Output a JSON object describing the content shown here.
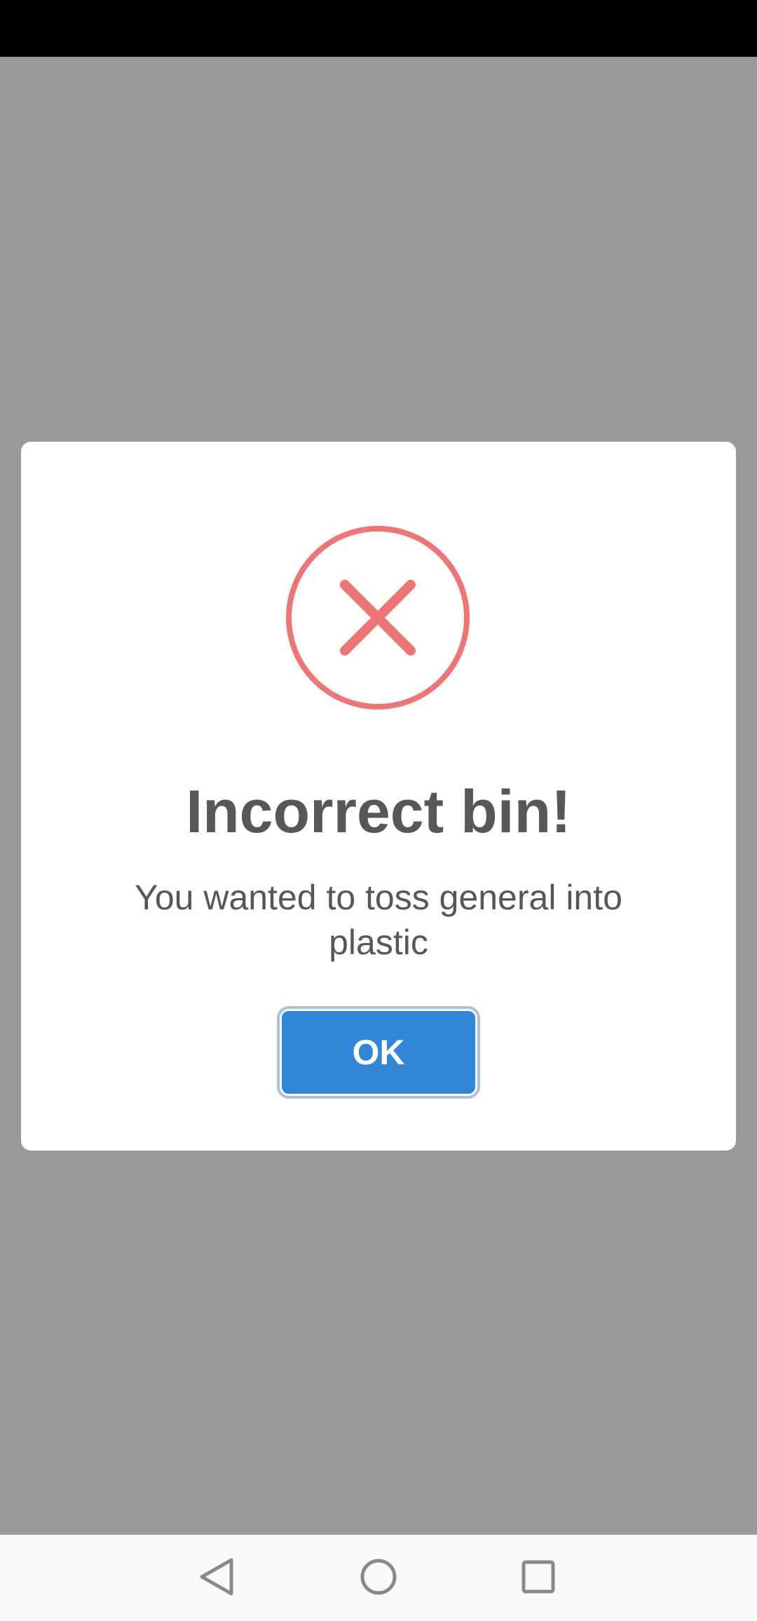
{
  "dialog": {
    "icon": "error-x-circle-icon",
    "title": "Incorrect bin!",
    "message": "You wanted to toss general into plastic",
    "ok_label": "OK"
  },
  "navigation": {
    "back_icon": "back-triangle-icon",
    "home_icon": "home-circle-icon",
    "recents_icon": "recents-square-icon"
  },
  "colors": {
    "overlay": "#9a9a9a",
    "status_bar": "#000000",
    "error_accent": "#ef7474",
    "text": "#575757",
    "button": "#3087d8"
  }
}
